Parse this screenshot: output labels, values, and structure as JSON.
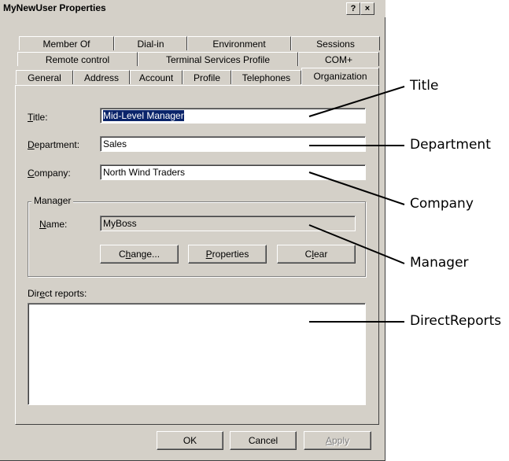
{
  "window": {
    "title": "MyNewUser Properties",
    "help_label": "?",
    "close_label": "×"
  },
  "tabs": {
    "row1": [
      "Member Of",
      "Dial-in",
      "Environment",
      "Sessions"
    ],
    "row2": [
      "Remote control",
      "Terminal Services Profile",
      "COM+"
    ],
    "row3": [
      "General",
      "Address",
      "Account",
      "Profile",
      "Telephones",
      "Organization"
    ],
    "active": "Organization"
  },
  "form": {
    "title": {
      "label_u": "T",
      "label_rest": "itle:",
      "value": "Mid-Level Manager"
    },
    "department": {
      "label_u": "D",
      "label_rest": "epartment:",
      "value": "Sales"
    },
    "company": {
      "label_u": "C",
      "label_rest": "ompany:",
      "value": "North Wind Traders"
    },
    "manager": {
      "group_label": "Manager",
      "name_label_u": "N",
      "name_label_rest": "ame:",
      "name_value": "MyBoss",
      "change_pre": "C",
      "change_u": "h",
      "change_post": "ange...",
      "properties_u": "P",
      "properties_post": "roperties",
      "clear_pre": "C",
      "clear_u": "l",
      "clear_post": "ear"
    },
    "direct_reports": {
      "label_pre": "Dir",
      "label_u": "e",
      "label_post": "ct reports:"
    }
  },
  "buttons": {
    "ok": "OK",
    "cancel": "Cancel",
    "apply_u": "A",
    "apply_post": "pply"
  },
  "callouts": {
    "title": "Title",
    "department": "Department",
    "company": "Company",
    "manager": "Manager",
    "direct_reports": "DirectReports"
  }
}
